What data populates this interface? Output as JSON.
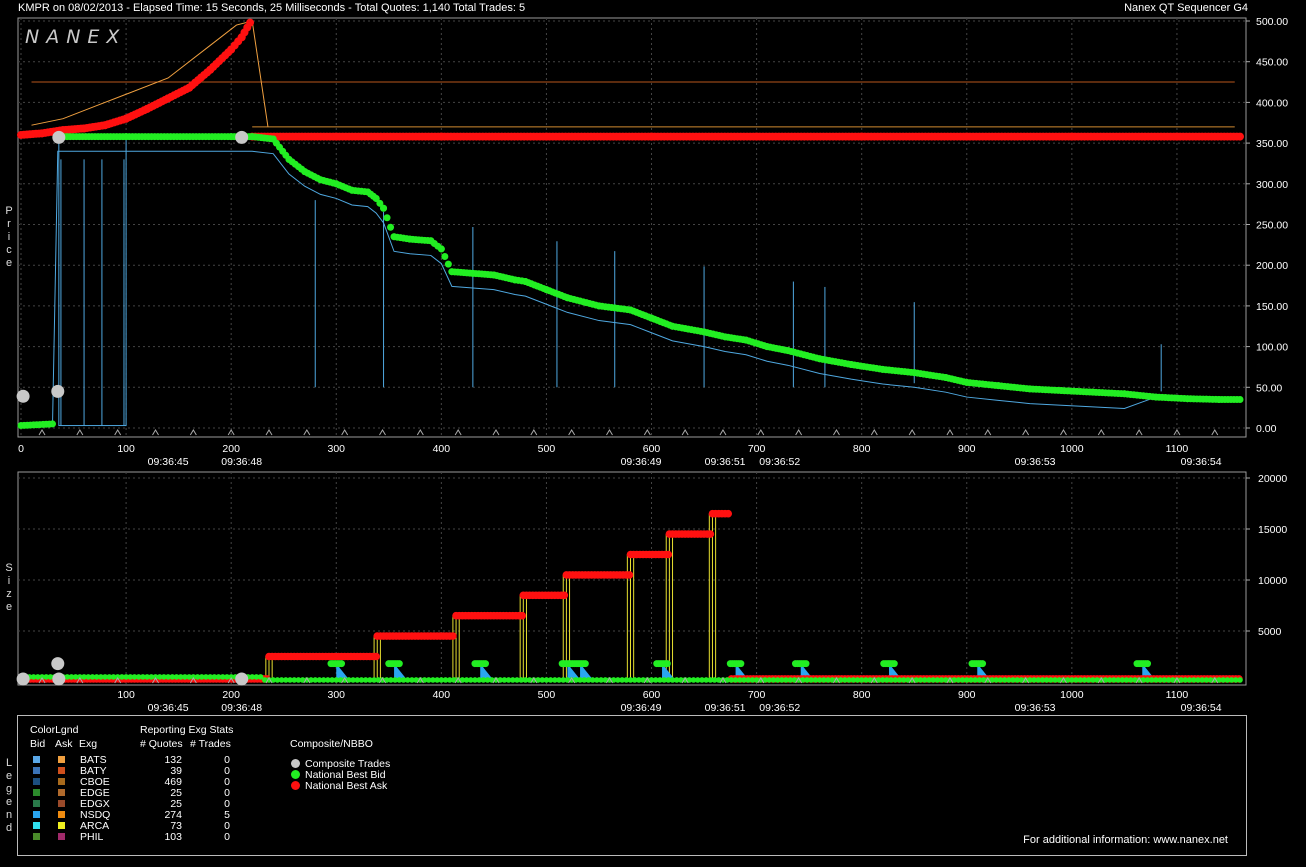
{
  "header": {
    "left": "KMPR on 08/02/2013  -  Elapsed Time: 15 Seconds, 25 Milliseconds  -  Total Quotes: 1,140  Total Trades: 5",
    "right": "Nanex QT Sequencer G4"
  },
  "logo": "NANEX",
  "side_labels": {
    "price": "Price",
    "size": "Size",
    "legend": "Legend"
  },
  "chart_data": [
    {
      "type": "scatter",
      "name": "Price",
      "xlim": [
        0,
        1160
      ],
      "ylim": [
        0,
        500
      ],
      "x_ticks": [
        0,
        100,
        200,
        300,
        400,
        500,
        600,
        700,
        800,
        900,
        1000,
        1100
      ],
      "y_ticks": [
        0,
        50,
        100,
        150,
        200,
        250,
        300,
        350,
        400,
        450,
        500
      ],
      "y_tick_labels": [
        "0.00",
        "50.00",
        "100.00",
        "150.00",
        "200.00",
        "250.00",
        "300.00",
        "350.00",
        "400.00",
        "450.00",
        "500.00"
      ],
      "time_labels": [
        {
          "x": 140,
          "label": "09:36:45"
        },
        {
          "x": 210,
          "label": "09:36:48"
        },
        {
          "x": 590,
          "label": "09:36:49"
        },
        {
          "x": 670,
          "label": "09:36:51"
        },
        {
          "x": 722,
          "label": "09:36:52"
        },
        {
          "x": 965,
          "label": "09:36:53"
        },
        {
          "x": 1123,
          "label": "09:36:54"
        }
      ],
      "series": [
        {
          "name": "National Best Ask",
          "color": "#ff1010",
          "points": [
            [
              0,
              360
            ],
            [
              20,
              362
            ],
            [
              40,
              366
            ],
            [
              60,
              368
            ],
            [
              80,
              372
            ],
            [
              100,
              380
            ],
            [
              120,
              392
            ],
            [
              140,
              405
            ],
            [
              160,
              418
            ],
            [
              180,
              440
            ],
            [
              200,
              465
            ],
            [
              210,
              480
            ],
            [
              218,
              498
            ],
            [
              220,
              358
            ],
            [
              300,
              358
            ],
            [
              400,
              358
            ],
            [
              500,
              358
            ],
            [
              600,
              358
            ],
            [
              700,
              358
            ],
            [
              800,
              358
            ],
            [
              900,
              358
            ],
            [
              1000,
              358
            ],
            [
              1100,
              358
            ],
            [
              1160,
              358
            ]
          ]
        },
        {
          "name": "National Best Bid",
          "color": "#22ee22",
          "points": [
            [
              0,
              3
            ],
            [
              30,
              5
            ],
            [
              35,
              358
            ],
            [
              100,
              358
            ],
            [
              200,
              358
            ],
            [
              220,
              358
            ],
            [
              240,
              355
            ],
            [
              255,
              330
            ],
            [
              270,
              315
            ],
            [
              285,
              305
            ],
            [
              300,
              300
            ],
            [
              315,
              292
            ],
            [
              330,
              290
            ],
            [
              338,
              282
            ],
            [
              345,
              270
            ],
            [
              355,
              235
            ],
            [
              370,
              232
            ],
            [
              390,
              230
            ],
            [
              400,
              220
            ],
            [
              410,
              192
            ],
            [
              430,
              190
            ],
            [
              450,
              188
            ],
            [
              470,
              182
            ],
            [
              480,
              180
            ],
            [
              500,
              170
            ],
            [
              520,
              160
            ],
            [
              550,
              150
            ],
            [
              580,
              145
            ],
            [
              600,
              135
            ],
            [
              620,
              125
            ],
            [
              650,
              118
            ],
            [
              670,
              112
            ],
            [
              690,
              108
            ],
            [
              710,
              100
            ],
            [
              730,
              95
            ],
            [
              760,
              85
            ],
            [
              790,
              78
            ],
            [
              820,
              72
            ],
            [
              850,
              68
            ],
            [
              880,
              62
            ],
            [
              900,
              56
            ],
            [
              930,
              52
            ],
            [
              960,
              48
            ],
            [
              990,
              46
            ],
            [
              1020,
              44
            ],
            [
              1050,
              42
            ],
            [
              1080,
              38
            ],
            [
              1110,
              36
            ],
            [
              1140,
              35
            ],
            [
              1160,
              35
            ]
          ]
        },
        {
          "name": "Composite Trades",
          "color": "#c8c8c8",
          "points": [
            [
              2,
              39
            ],
            [
              35,
              45
            ],
            [
              36,
              357
            ],
            [
              210,
              357
            ]
          ]
        }
      ]
    },
    {
      "type": "scatter",
      "name": "Size",
      "xlim": [
        0,
        1160
      ],
      "ylim": [
        0,
        20000
      ],
      "x_ticks": [
        100,
        200,
        300,
        400,
        500,
        600,
        700,
        800,
        900,
        1000,
        1100
      ],
      "y_ticks": [
        5000,
        10000,
        15000,
        20000
      ],
      "y_tick_labels": [
        "5000",
        "10000",
        "15000",
        "20000"
      ],
      "ask_steps": [
        {
          "x0": 0,
          "x1": 235,
          "size": 300
        },
        {
          "x0": 236,
          "x1": 338,
          "size": 2500
        },
        {
          "x0": 339,
          "x1": 413,
          "size": 4500
        },
        {
          "x0": 414,
          "x1": 477,
          "size": 6500
        },
        {
          "x0": 478,
          "x1": 518,
          "size": 8500
        },
        {
          "x0": 519,
          "x1": 579,
          "size": 10500
        },
        {
          "x0": 580,
          "x1": 616,
          "size": 12500
        },
        {
          "x0": 617,
          "x1": 657,
          "size": 14500
        },
        {
          "x0": 658,
          "x1": 675,
          "size": 16500
        },
        {
          "x0": 676,
          "x1": 1160,
          "size": 300
        }
      ],
      "bid_clusters": [
        {
          "x": 300,
          "size": 1800
        },
        {
          "x": 355,
          "size": 1800
        },
        {
          "x": 437,
          "size": 1800
        },
        {
          "x": 520,
          "size": 1800
        },
        {
          "x": 532,
          "size": 1800
        },
        {
          "x": 610,
          "size": 1800
        },
        {
          "x": 680,
          "size": 1800
        },
        {
          "x": 742,
          "size": 1800
        },
        {
          "x": 826,
          "size": 1800
        },
        {
          "x": 910,
          "size": 1800
        },
        {
          "x": 1067,
          "size": 1800
        }
      ],
      "trades": [
        {
          "x": 2,
          "size": 300
        },
        {
          "x": 35,
          "size": 1800
        },
        {
          "x": 36,
          "size": 300
        },
        {
          "x": 210,
          "size": 300
        }
      ]
    }
  ],
  "legend": {
    "colorlgnd_title": "ColorLgnd",
    "stats_title": "Reporting Exg Stats",
    "headers": {
      "bid": "Bid",
      "ask": "Ask",
      "exg": "Exg",
      "quotes": "# Quotes",
      "trades": "# Trades"
    },
    "rows": [
      {
        "exg": "BATS",
        "quotes": "132",
        "trades": "0",
        "bid": "#5aa8e8",
        "ask": "#f0a040"
      },
      {
        "exg": "BATY",
        "quotes": "39",
        "trades": "0",
        "bid": "#3b74b8",
        "ask": "#d0501c"
      },
      {
        "exg": "CBOE",
        "quotes": "469",
        "trades": "0",
        "bid": "#1c4f80",
        "ask": "#a86a1c"
      },
      {
        "exg": "EDGE",
        "quotes": "25",
        "trades": "0",
        "bid": "#2c8a2c",
        "ask": "#b06a2c"
      },
      {
        "exg": "EDGX",
        "quotes": "25",
        "trades": "0",
        "bid": "#2a7a4a",
        "ask": "#9a4a2a"
      },
      {
        "exg": "NSDQ",
        "quotes": "274",
        "trades": "5",
        "bid": "#2aa6f0",
        "ask": "#f08c10"
      },
      {
        "exg": "ARCA",
        "quotes": "73",
        "trades": "0",
        "bid": "#30e0f0",
        "ask": "#f0f020"
      },
      {
        "exg": "PHIL",
        "quotes": "103",
        "trades": "0",
        "bid": "#4a8a2a",
        "ask": "#a02a6a"
      }
    ],
    "nbbo_title": "Composite/NBBO",
    "nbbo_items": [
      {
        "label": "Composite Trades",
        "color": "#c8c8c8"
      },
      {
        "label": "National Best Bid",
        "color": "#22ee22"
      },
      {
        "label": "National Best Ask",
        "color": "#ff1010"
      }
    ],
    "footer": "For additional information: www.nanex.net"
  }
}
